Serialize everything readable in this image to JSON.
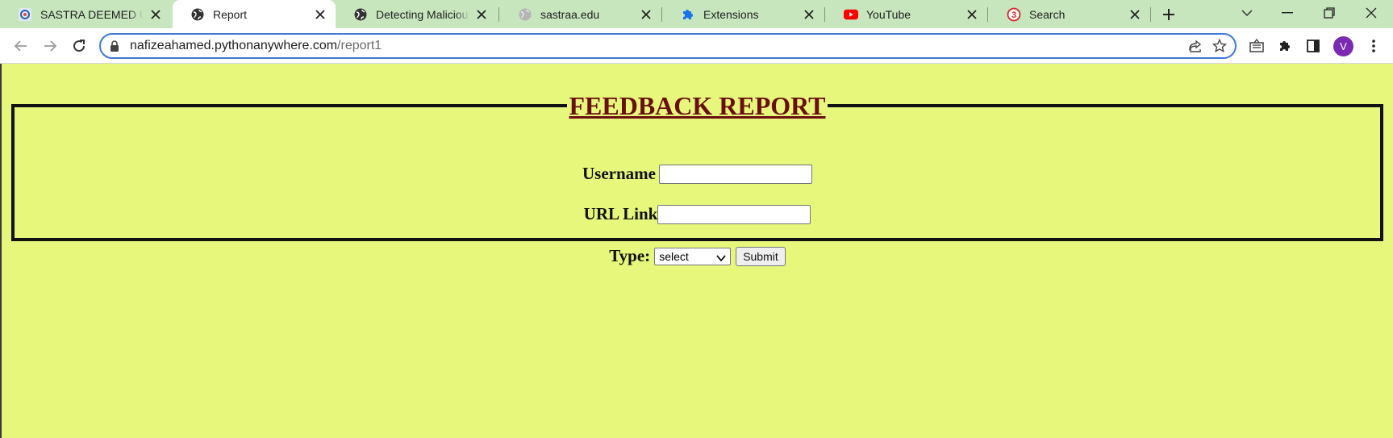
{
  "browser": {
    "tabs": [
      {
        "title": "SASTRA DEEMED UNIVERSITY",
        "icon": "sastra-logo-icon",
        "active": false
      },
      {
        "title": "Report",
        "icon": "globe-icon",
        "active": true
      },
      {
        "title": "Detecting Malicious URLs",
        "icon": "globe-icon",
        "active": false
      },
      {
        "title": "sastraa.edu",
        "icon": "globe-grey-icon",
        "active": false
      },
      {
        "title": "Extensions",
        "icon": "puzzle-icon",
        "active": false
      },
      {
        "title": "YouTube",
        "icon": "youtube-icon",
        "active": false
      },
      {
        "title": "Search",
        "icon": "search-badge-icon",
        "badge": "3",
        "active": false
      }
    ],
    "url_host": "nafizeahamed.pythonanywhere.com",
    "url_path": "/report1",
    "profile_initial": "V",
    "colors": {
      "tabstrip": "#c7e6bd",
      "omnibox_border": "#3f78d8",
      "avatar": "#7b2bb3"
    }
  },
  "page": {
    "heading": "FEEDBACK REPORT",
    "username_label": "Username",
    "username_value": "",
    "url_label": "URL Link",
    "url_value": "",
    "type_label": "Type:",
    "type_selected": "select",
    "submit_label": "Submit",
    "colors": {
      "background": "#e6f77c",
      "heading": "#6a0f0f",
      "border": "#111111"
    }
  }
}
